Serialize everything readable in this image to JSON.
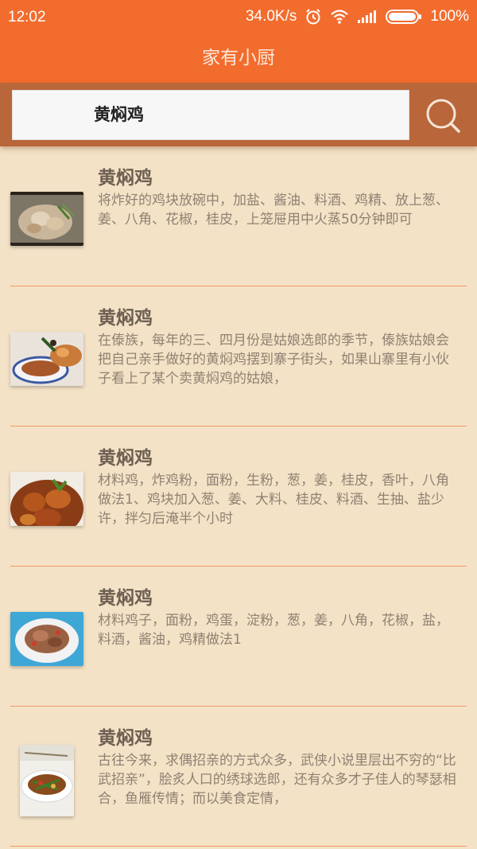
{
  "status_bar": {
    "time": "12:02",
    "network_speed": "34.0K/s",
    "battery": "100%",
    "icons": [
      "alarm-icon",
      "wifi-icon",
      "signal-icon",
      "battery-icon"
    ]
  },
  "app": {
    "title": "家有小厨"
  },
  "search": {
    "query": "黄焖鸡",
    "icon": "search-icon"
  },
  "recipes": [
    {
      "title": "黄焖鸡",
      "description": "将炸好的鸡块放碗中，加盐、酱油、料酒、鸡精、放上葱、姜、八角、花椒，桂皮，上笼屉用中火蒸50分钟即可"
    },
    {
      "title": "黄焖鸡",
      "description": "在傣族，每年的三、四月份是姑娘选郎的季节，傣族姑娘会把自己亲手做好的黄焖鸡摆到寨子街头，如果山寨里有小伙子看上了某个卖黄焖鸡的姑娘，"
    },
    {
      "title": "黄焖鸡",
      "description": "材料鸡，炸鸡粉，面粉，生粉，葱，姜，桂皮，香叶，八角做法1、鸡块加入葱、姜、大料、桂皮、料酒、生抽、盐少许，拌匀后淹半个小时"
    },
    {
      "title": "黄焖鸡",
      "description": "材料鸡子，面粉，鸡蛋，淀粉，葱，姜，八角，花椒，盐，料酒，酱油，鸡精做法1"
    },
    {
      "title": "黄焖鸡",
      "description": "古往今来，求偶招亲的方式众多，武侠小说里层出不穷的“比武招亲”，脍炙人口的绣球选郎，还有众多才子佳人的琴瑟相合，鱼雁传情；而以美食定情，"
    }
  ],
  "colors": {
    "primary": "#f26c2e",
    "background": "#f4e2c6",
    "divider": "#ec9a66"
  }
}
